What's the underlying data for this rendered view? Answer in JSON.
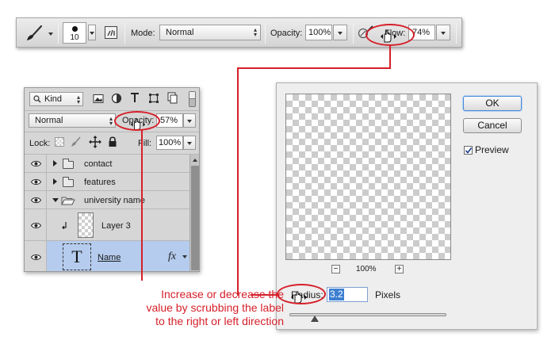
{
  "options_bar": {
    "brush_size": "10",
    "mode_label": "Mode:",
    "mode_value": "Normal",
    "opacity_label": "Opacity:",
    "opacity_value": "100%",
    "flow_label": "Flow:",
    "flow_value": "74%"
  },
  "layers_panel": {
    "filter_kind": "Kind",
    "blend_mode": "Normal",
    "opacity_label": "Opacity:",
    "opacity_value": "57%",
    "lock_label": "Lock:",
    "fill_label": "Fill:",
    "fill_value": "100%",
    "layers": [
      {
        "name": "contact",
        "type": "group",
        "expanded": false
      },
      {
        "name": "features",
        "type": "group",
        "expanded": false
      },
      {
        "name": "university name",
        "type": "group",
        "expanded": true
      },
      {
        "name": "Layer 3",
        "type": "pixel"
      },
      {
        "name": "Name",
        "type": "text",
        "fx": "fx",
        "selected": true
      }
    ]
  },
  "dialog": {
    "ok_label": "OK",
    "cancel_label": "Cancel",
    "preview_label": "Preview",
    "preview_checked": true,
    "zoom_minus": "−",
    "zoom_level": "100%",
    "zoom_plus": "+",
    "radius_label": "Radius:",
    "radius_value": "3.2",
    "radius_unit": "Pixels",
    "radius_slider_fraction": 0.16
  },
  "annotation": {
    "lines": [
      "Increase or decrease the",
      "value by scrubbing the label",
      "to the right or left direction"
    ],
    "color": "#d6202a"
  },
  "icons": [
    "brush-icon",
    "brush-panel-icon",
    "airbrush-icon",
    "scrub-hand-cursor-icon",
    "eye-icon",
    "folder-icon",
    "lock-icon",
    "move-icon",
    "text-layer-icon",
    "fx-icon"
  ]
}
